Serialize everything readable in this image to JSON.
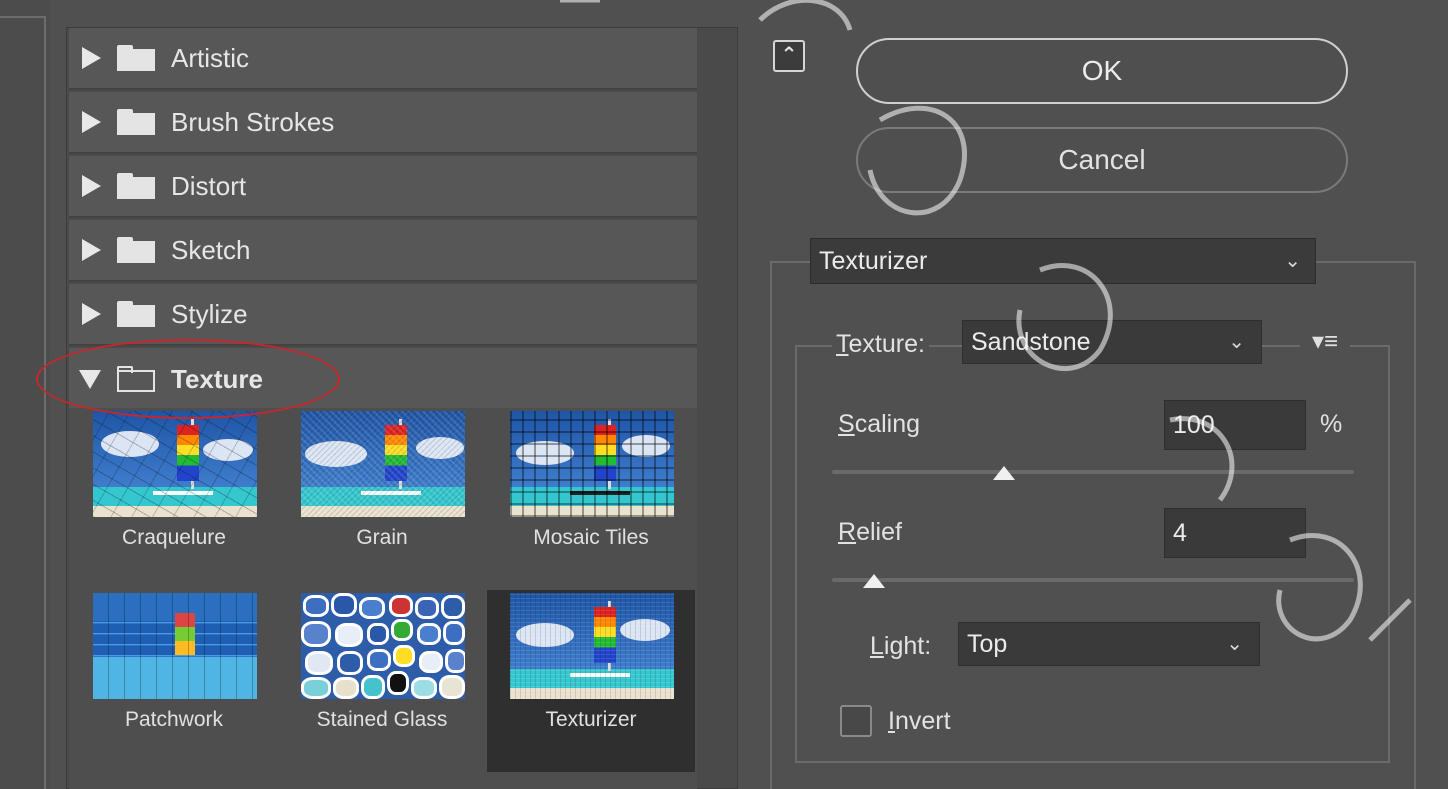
{
  "categories": [
    {
      "label": "Artistic",
      "state": "collapsed"
    },
    {
      "label": "Brush Strokes",
      "state": "collapsed"
    },
    {
      "label": "Distort",
      "state": "collapsed"
    },
    {
      "label": "Sketch",
      "state": "collapsed"
    },
    {
      "label": "Stylize",
      "state": "collapsed"
    },
    {
      "label": "Texture",
      "state": "expanded"
    }
  ],
  "thumbnails": [
    {
      "label": "Craquelure",
      "selected": false
    },
    {
      "label": "Grain",
      "selected": false
    },
    {
      "label": "Mosaic Tiles",
      "selected": false
    },
    {
      "label": "Patchwork",
      "selected": false
    },
    {
      "label": "Stained Glass",
      "selected": false
    },
    {
      "label": "Texturizer",
      "selected": true
    }
  ],
  "buttons": {
    "ok": "OK",
    "cancel": "Cancel",
    "collapse_icon": "double-chevron-up-icon"
  },
  "filter_select": {
    "value": "Texturizer"
  },
  "options": {
    "texture": {
      "label_u": "T",
      "label_rest": "exture:",
      "value": "Sandstone"
    },
    "scaling": {
      "label_u": "S",
      "label_rest": "caling",
      "value": "100",
      "unit": "%",
      "level": 0.33
    },
    "relief": {
      "label_u": "R",
      "label_rest": "elief",
      "value": "4",
      "level": 0.08
    },
    "light": {
      "label_u": "L",
      "label_rest": "ight:",
      "value": "Top"
    },
    "invert": {
      "label_u": "I",
      "label_rest": "nvert",
      "checked": false
    }
  },
  "colors": {
    "background": "#505050",
    "panel": "#4a4a4a",
    "annotation": "#c8262a"
  }
}
